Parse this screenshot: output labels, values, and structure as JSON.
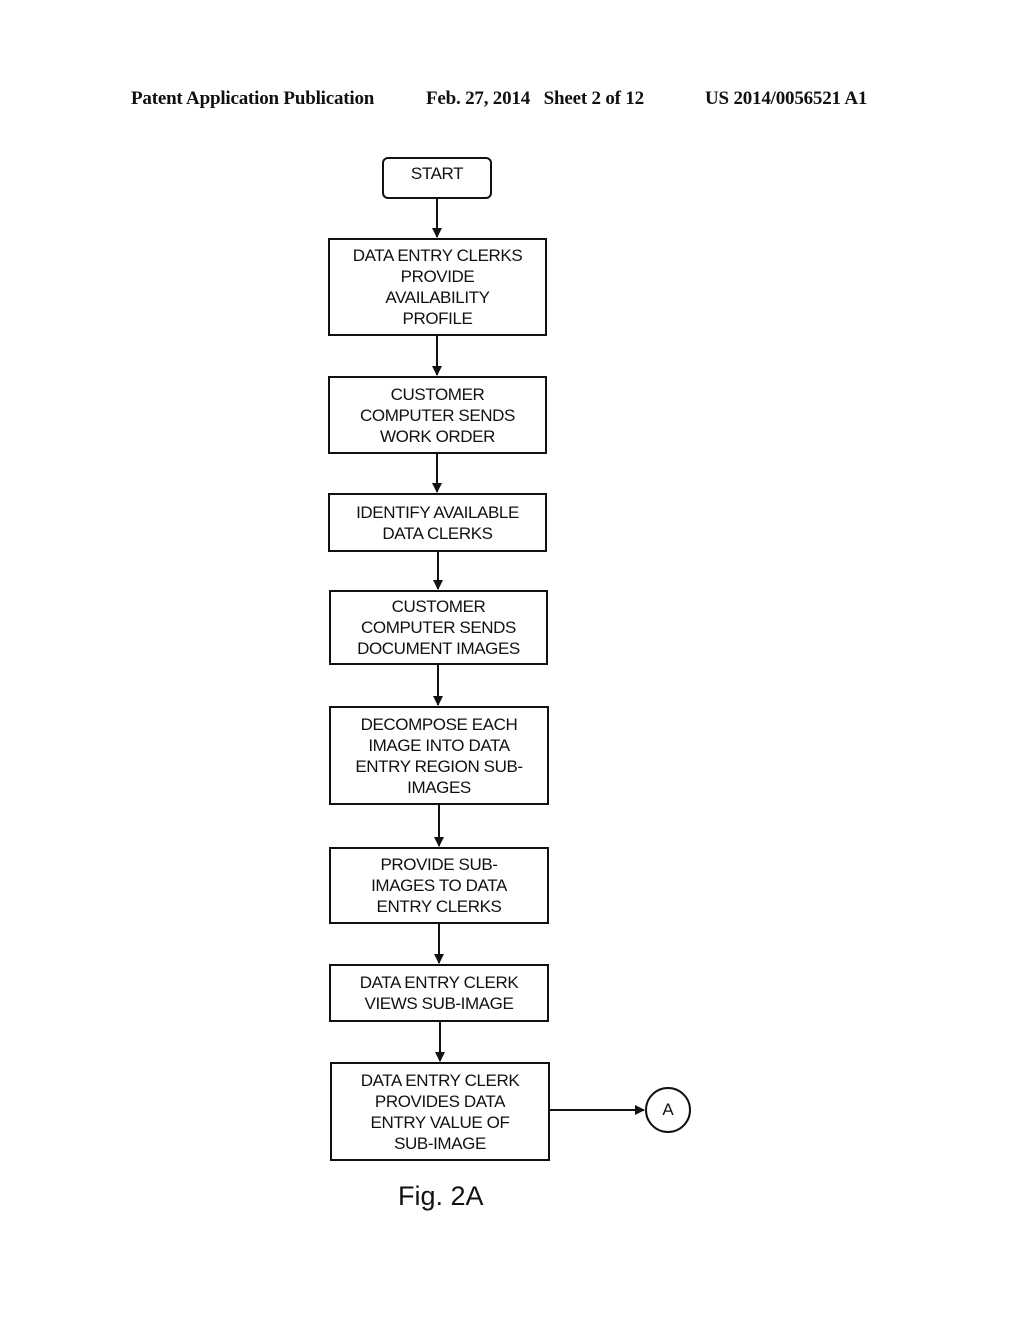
{
  "header": {
    "publication": "Patent Application Publication",
    "date_sheet": "Feb. 27, 2014   Sheet 2 of 12",
    "number": "US 2014/0056521 A1"
  },
  "flowchart": {
    "start": "START",
    "steps": [
      {
        "lines": [
          "DATA ENTRY CLERKS",
          "PROVIDE",
          "AVAILABILITY",
          "PROFILE"
        ]
      },
      {
        "lines": [
          "CUSTOMER",
          "COMPUTER SENDS",
          "WORK ORDER"
        ]
      },
      {
        "lines": [
          "IDENTIFY AVAILABLE",
          "DATA CLERKS"
        ]
      },
      {
        "lines": [
          "CUSTOMER",
          "COMPUTER SENDS",
          "DOCUMENT IMAGES"
        ]
      },
      {
        "lines": [
          "DECOMPOSE EACH",
          "IMAGE INTO DATA",
          "ENTRY REGION SUB-",
          "IMAGES"
        ]
      },
      {
        "lines": [
          "PROVIDE SUB-",
          "IMAGES TO DATA",
          "ENTRY CLERKS"
        ]
      },
      {
        "lines": [
          "DATA ENTRY CLERK",
          "VIEWS SUB-IMAGE"
        ]
      },
      {
        "lines": [
          "DATA ENTRY CLERK",
          "PROVIDES DATA",
          "ENTRY VALUE OF",
          "SUB-IMAGE"
        ]
      }
    ],
    "connector": "A"
  },
  "figure_label": "Fig. 2A"
}
